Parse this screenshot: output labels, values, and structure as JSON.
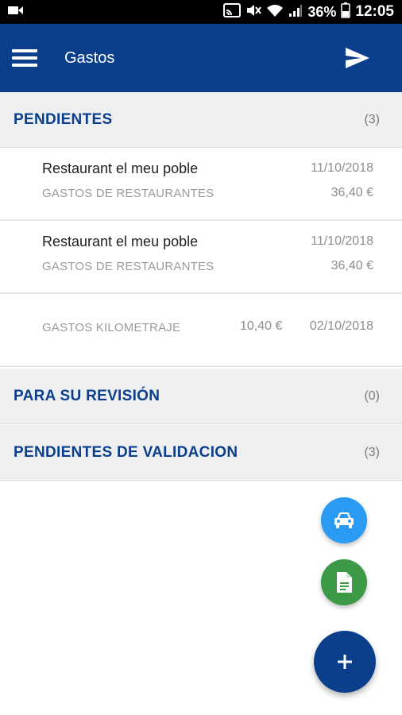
{
  "status_bar": {
    "battery": "36%",
    "time": "12:05",
    "icons": [
      "video-camera-icon",
      "cast-icon",
      "mute-icon",
      "wifi-icon",
      "signal-icon",
      "battery-icon"
    ]
  },
  "app_bar": {
    "title": "Gastos",
    "menu_icon": "menu-icon",
    "send_icon": "send-icon",
    "color": "#0b3f8c"
  },
  "sections": {
    "pendientes": {
      "title": "PENDIENTES",
      "count": "(3)"
    },
    "revision": {
      "title": "PARA SU REVISIÓN",
      "count": "(0)"
    },
    "validacion": {
      "title": "PENDIENTES DE VALIDACION",
      "count": "(3)"
    }
  },
  "expenses": [
    {
      "name": "Restaurant el meu poble",
      "category": "GASTOS DE RESTAURANTES",
      "date": "11/10/2018",
      "amount": "36,40 €"
    },
    {
      "name": "Restaurant el meu poble",
      "category": "GASTOS DE RESTAURANTES",
      "date": "11/10/2018",
      "amount": "36,40 €"
    },
    {
      "name": "",
      "category": "GASTOS KILOMETRAJE",
      "date": "02/10/2018",
      "amount": "10,40 €"
    }
  ],
  "fabs": {
    "car": {
      "icon": "car-icon",
      "color": "#2a9af3"
    },
    "document": {
      "icon": "document-icon",
      "color": "#3c9a46"
    },
    "add": {
      "icon": "plus-icon",
      "color": "#0b3f8c"
    }
  }
}
